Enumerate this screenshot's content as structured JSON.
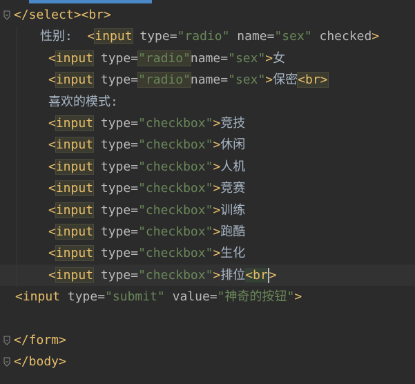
{
  "lines": [
    {
      "indent": 20,
      "fold": true,
      "tokens": [
        {
          "cls": "tag",
          "t": "</select><br>"
        }
      ]
    },
    {
      "indent": 58,
      "tokens": [
        {
          "cls": "txt",
          "t": "性别:  "
        },
        {
          "cls": "tag",
          "t": "<"
        },
        {
          "cls": "tag hl",
          "t": "input"
        },
        {
          "cls": "attr",
          "t": " type="
        },
        {
          "cls": "str",
          "t": "\"radio\""
        },
        {
          "cls": "attr",
          "t": " name="
        },
        {
          "cls": "str",
          "t": "\"sex\""
        },
        {
          "cls": "attr",
          "t": " checked"
        },
        {
          "cls": "tag",
          "t": ">"
        }
      ]
    },
    {
      "indent": 70,
      "tokens": [
        {
          "cls": "tag",
          "t": "<"
        },
        {
          "cls": "tag hl",
          "t": "input"
        },
        {
          "cls": "attr",
          "t": " type="
        },
        {
          "cls": "str hl",
          "t": "\"radio\""
        },
        {
          "cls": "attr",
          "t": "name="
        },
        {
          "cls": "str",
          "t": "\"sex\""
        },
        {
          "cls": "tag",
          "t": ">"
        },
        {
          "cls": "txt",
          "t": "女"
        }
      ]
    },
    {
      "indent": 70,
      "tokens": [
        {
          "cls": "tag",
          "t": "<"
        },
        {
          "cls": "tag hl",
          "t": "input"
        },
        {
          "cls": "attr",
          "t": " type="
        },
        {
          "cls": "str hl",
          "t": "\"radio\""
        },
        {
          "cls": "attr",
          "t": "name="
        },
        {
          "cls": "str",
          "t": "\"sex\""
        },
        {
          "cls": "tag",
          "t": ">"
        },
        {
          "cls": "txt",
          "t": "保密"
        },
        {
          "cls": "tag hl",
          "t": "<br>"
        }
      ]
    },
    {
      "indent": 70,
      "tokens": [
        {
          "cls": "txt",
          "t": "喜欢的模式:"
        }
      ]
    },
    {
      "indent": 70,
      "tokens": [
        {
          "cls": "tag",
          "t": "<"
        },
        {
          "cls": "tag hl",
          "t": "input"
        },
        {
          "cls": "attr",
          "t": " type="
        },
        {
          "cls": "str",
          "t": "\"checkbox\""
        },
        {
          "cls": "tag",
          "t": ">"
        },
        {
          "cls": "txt",
          "t": "竞技"
        }
      ]
    },
    {
      "indent": 70,
      "tokens": [
        {
          "cls": "tag",
          "t": "<"
        },
        {
          "cls": "tag hl",
          "t": "input"
        },
        {
          "cls": "attr",
          "t": " type="
        },
        {
          "cls": "str",
          "t": "\"checkbox\""
        },
        {
          "cls": "tag",
          "t": ">"
        },
        {
          "cls": "txt",
          "t": "休闲"
        }
      ]
    },
    {
      "indent": 70,
      "tokens": [
        {
          "cls": "tag",
          "t": "<"
        },
        {
          "cls": "tag hl",
          "t": "input"
        },
        {
          "cls": "attr",
          "t": " type="
        },
        {
          "cls": "str",
          "t": "\"checkbox\""
        },
        {
          "cls": "tag",
          "t": ">"
        },
        {
          "cls": "txt",
          "t": "人机"
        }
      ]
    },
    {
      "indent": 70,
      "tokens": [
        {
          "cls": "tag",
          "t": "<"
        },
        {
          "cls": "tag hl",
          "t": "input"
        },
        {
          "cls": "attr",
          "t": " type="
        },
        {
          "cls": "str",
          "t": "\"checkbox\""
        },
        {
          "cls": "tag",
          "t": ">"
        },
        {
          "cls": "txt",
          "t": "竞赛"
        }
      ]
    },
    {
      "indent": 70,
      "tokens": [
        {
          "cls": "tag",
          "t": "<"
        },
        {
          "cls": "tag hl",
          "t": "input"
        },
        {
          "cls": "attr",
          "t": " type="
        },
        {
          "cls": "str",
          "t": "\"checkbox\""
        },
        {
          "cls": "tag",
          "t": ">"
        },
        {
          "cls": "txt",
          "t": "训练"
        }
      ]
    },
    {
      "indent": 70,
      "tokens": [
        {
          "cls": "tag",
          "t": "<"
        },
        {
          "cls": "tag hl",
          "t": "input"
        },
        {
          "cls": "attr",
          "t": " type="
        },
        {
          "cls": "str",
          "t": "\"checkbox\""
        },
        {
          "cls": "tag",
          "t": ">"
        },
        {
          "cls": "txt",
          "t": "跑酷"
        }
      ]
    },
    {
      "indent": 70,
      "tokens": [
        {
          "cls": "tag",
          "t": "<"
        },
        {
          "cls": "tag hl",
          "t": "input"
        },
        {
          "cls": "attr",
          "t": " type="
        },
        {
          "cls": "str",
          "t": "\"checkbox\""
        },
        {
          "cls": "tag",
          "t": ">"
        },
        {
          "cls": "txt",
          "t": "生化"
        }
      ]
    },
    {
      "indent": 70,
      "current": true,
      "tokens": [
        {
          "cls": "tag",
          "t": "<"
        },
        {
          "cls": "tag hl",
          "t": "input"
        },
        {
          "cls": "attr",
          "t": " type="
        },
        {
          "cls": "str",
          "t": "\"checkbox\""
        },
        {
          "cls": "tag",
          "t": ">"
        },
        {
          "cls": "txt",
          "t": "排位"
        },
        {
          "cls": "tag hl2",
          "t": "<br"
        },
        {
          "cls": "caret",
          "t": ""
        },
        {
          "cls": "tag",
          "t": ">"
        }
      ]
    },
    {
      "indent": 22,
      "tokens": [
        {
          "cls": "tag",
          "t": "<input"
        },
        {
          "cls": "attr",
          "t": " type="
        },
        {
          "cls": "str",
          "t": "\"submit\""
        },
        {
          "cls": "attr",
          "t": " value="
        },
        {
          "cls": "str",
          "t": "\"神奇的按钮\""
        },
        {
          "cls": "tag",
          "t": ">"
        }
      ]
    },
    {
      "indent": 22,
      "tokens": []
    },
    {
      "indent": 20,
      "fold": true,
      "tokens": [
        {
          "cls": "tag",
          "t": "</form>"
        }
      ]
    },
    {
      "indent": 20,
      "fold": true,
      "tokens": [
        {
          "cls": "tag",
          "t": "</body>"
        }
      ]
    }
  ]
}
